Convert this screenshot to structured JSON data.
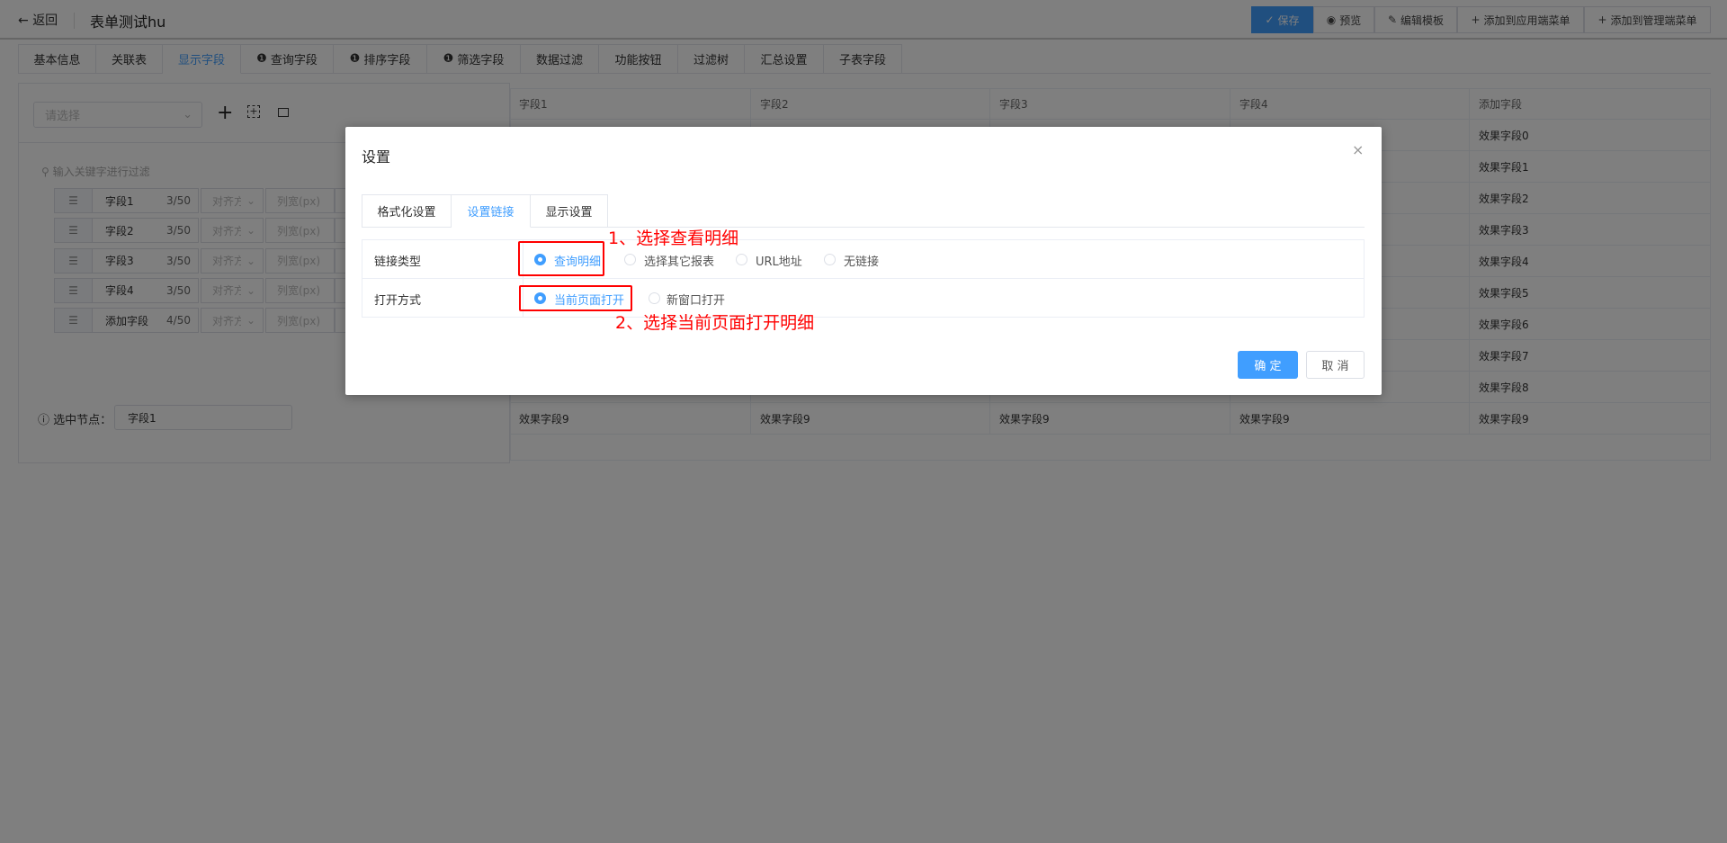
{
  "header": {
    "back_label": "返回",
    "title": "表单测试hu",
    "buttons": {
      "save": "保存",
      "preview": "预览",
      "edit_template": "编辑模板",
      "add_app_menu": "添加到应用端菜单",
      "add_admin_menu": "添加到管理端菜单"
    }
  },
  "tabs": [
    "基本信息",
    "关联表",
    "显示字段",
    "查询字段",
    "排序字段",
    "筛选字段",
    "数据过滤",
    "功能按钮",
    "过滤树",
    "汇总设置",
    "子表字段"
  ],
  "left_panel": {
    "select_placeholder": "请选择",
    "filter_placeholder": "输入关键字进行过滤",
    "fields": [
      {
        "name": "字段1",
        "count": "3/50",
        "align": "对齐方",
        "width": "列宽(px)"
      },
      {
        "name": "字段2",
        "count": "3/50",
        "align": "对齐方",
        "width": "列宽(px)"
      },
      {
        "name": "字段3",
        "count": "3/50",
        "align": "对齐方",
        "width": "列宽(px)"
      },
      {
        "name": "字段4",
        "count": "3/50",
        "align": "对齐方",
        "width": "列宽(px)"
      },
      {
        "name": "添加字段",
        "count": "4/50",
        "align": "对齐方",
        "width": "列宽(px)"
      }
    ],
    "selected_node_label": "选中节点：",
    "selected_node_value": "字段1"
  },
  "table": {
    "headers": [
      "字段1",
      "字段2",
      "字段3",
      "字段4",
      "添加字段"
    ],
    "last_col": [
      "效果字段0",
      "效果字段1",
      "效果字段2",
      "效果字段3",
      "效果字段4",
      "效果字段5",
      "效果字段6",
      "效果字段7",
      "效果字段8",
      "效果字段9"
    ],
    "last_row": [
      "效果字段9",
      "效果字段9",
      "效果字段9",
      "效果字段9",
      "效果字段9"
    ]
  },
  "dialog": {
    "title": "设置",
    "tabs": [
      "格式化设置",
      "设置链接",
      "显示设置"
    ],
    "link_type_label": "链接类型",
    "link_type_options": [
      "查询明细",
      "选择其它报表",
      "URL地址",
      "无链接"
    ],
    "open_mode_label": "打开方式",
    "open_mode_options": [
      "当前页面打开",
      "新窗口打开"
    ],
    "confirm": "确 定",
    "cancel": "取 消"
  },
  "annotations": [
    "1、选择查看明细",
    "2、选择当前页面打开明细"
  ],
  "colors": {
    "primary": "#409eff",
    "annotation": "#ff0000"
  }
}
